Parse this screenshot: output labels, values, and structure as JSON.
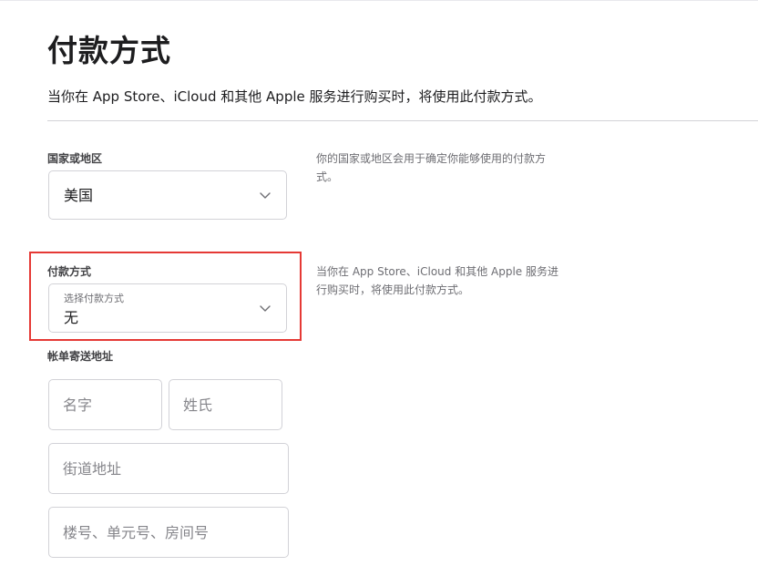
{
  "page": {
    "title": "付款方式",
    "subtitle": "当你在 App Store、iCloud 和其他 Apple 服务进行购买时，将使用此付款方式。"
  },
  "country": {
    "label": "国家或地区",
    "value": "美国",
    "help": "你的国家或地区会用于确定你能够使用的付款方式。"
  },
  "payment": {
    "label": "付款方式",
    "select_label": "选择付款方式",
    "value": "无",
    "help": "当你在 App Store、iCloud 和其他 Apple 服务进行购买时，将使用此付款方式。"
  },
  "billing": {
    "label": "帐单寄送地址",
    "first_name_placeholder": "名字",
    "last_name_placeholder": "姓氏",
    "street_placeholder": "街道地址",
    "unit_placeholder": "楼号、单元号、房间号"
  },
  "colors": {
    "highlight": "#e53935",
    "border": "#d2d2d7",
    "text": "#1d1d1f"
  },
  "icons": {
    "chevron": "chevron-down-icon"
  }
}
